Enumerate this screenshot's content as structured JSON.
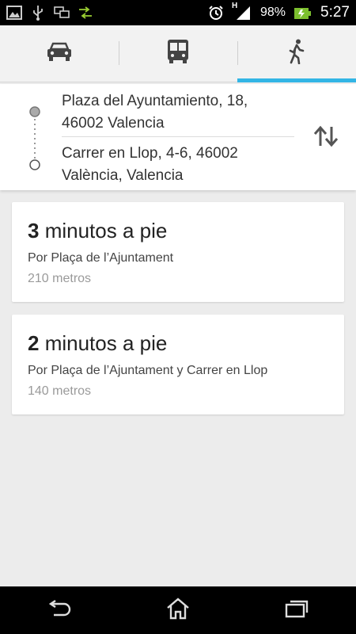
{
  "status_bar": {
    "battery_pct": "98%",
    "time": "5:27",
    "signal_type": "H",
    "icons": [
      "gallery-icon",
      "usb-icon",
      "screen-mirror-icon",
      "data-toggle-icon",
      "alarm-icon",
      "signal-icon",
      "battery-icon"
    ]
  },
  "tabs": [
    {
      "name": "car",
      "icon": "car-icon",
      "active": false
    },
    {
      "name": "transit",
      "icon": "bus-icon",
      "active": false
    },
    {
      "name": "walk",
      "icon": "walk-icon",
      "active": true
    }
  ],
  "route": {
    "from_lines": [
      "Plaza del Ayuntamiento, 18,",
      "46002 Valencia"
    ],
    "to_lines": [
      "Carrer en Llop, 4-6, 46002",
      "València, Valencia"
    ]
  },
  "results": [
    {
      "duration_num": "3",
      "duration_unit": " minutos a pie",
      "via": "Por Plaça de l’Ajuntament",
      "distance": "210 metros"
    },
    {
      "duration_num": "2",
      "duration_unit": " minutos a pie",
      "via": "Por Plaça de l’Ajuntament y Carrer en Llop",
      "distance": "140 metros"
    }
  ],
  "colors": {
    "accent": "#33b5e5",
    "background": "#ececec"
  }
}
